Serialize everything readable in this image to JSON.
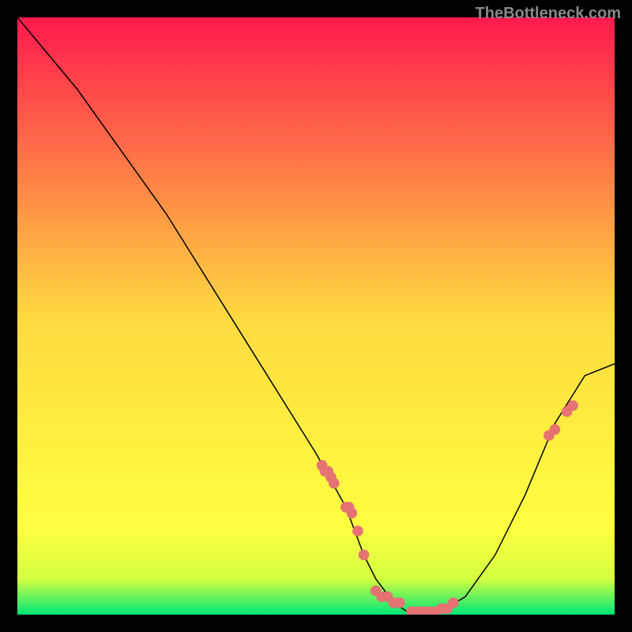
{
  "attribution": "TheBottleneck.com",
  "chart_data": {
    "type": "line",
    "title": "",
    "xlabel": "",
    "ylabel": "",
    "xlim": [
      0,
      100
    ],
    "ylim": [
      0,
      100
    ],
    "background_gradient": {
      "stops": [
        {
          "offset": 0,
          "color": "#ff1a4d"
        },
        {
          "offset": 50,
          "color": "#ffd940"
        },
        {
          "offset": 85,
          "color": "#ffff40"
        },
        {
          "offset": 94,
          "color": "#d4ff40"
        },
        {
          "offset": 100,
          "color": "#00e676"
        }
      ]
    },
    "curve": {
      "x": [
        0,
        5,
        10,
        15,
        20,
        25,
        30,
        35,
        40,
        45,
        50,
        55,
        58,
        60,
        63,
        66,
        70,
        75,
        80,
        85,
        90,
        95,
        100
      ],
      "y": [
        100,
        94,
        88,
        81,
        74,
        67,
        59,
        51,
        43,
        35,
        27,
        18,
        10,
        6,
        2,
        0,
        0,
        3,
        10,
        20,
        32,
        40,
        42
      ]
    },
    "points": {
      "x": [
        51,
        51.5,
        52,
        52.5,
        53,
        55,
        55.5,
        56,
        57,
        58,
        60,
        61,
        62,
        63,
        64,
        66,
        67,
        68,
        69,
        70,
        71,
        72,
        73,
        89,
        90,
        92,
        93
      ],
      "y": [
        25,
        24,
        24,
        23,
        22,
        18,
        18,
        17,
        14,
        10,
        4,
        3,
        3,
        2,
        2,
        0.5,
        0.5,
        0.5,
        0.5,
        0.5,
        1,
        1,
        2,
        30,
        31,
        34,
        35
      ]
    },
    "point_style": {
      "color": "#e57373",
      "size": 6
    }
  }
}
